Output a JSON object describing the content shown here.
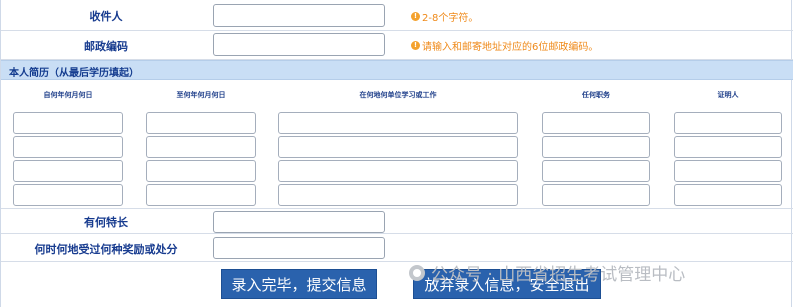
{
  "recipient": {
    "label": "收件人",
    "value": "",
    "hint": "2-8个字符。"
  },
  "postal": {
    "label": "邮政编码",
    "value": "",
    "hint": "请输入和邮寄地址对应的6位邮政编码。"
  },
  "resume": {
    "title": "本人简历（从最后学历填起）",
    "columns": [
      "自何年何月何日",
      "至何年何月何日",
      "在何地何单位学习或工作",
      "任何职务",
      "证明人"
    ],
    "rows": [
      [
        "",
        "",
        "",
        "",
        ""
      ],
      [
        "",
        "",
        "",
        "",
        ""
      ],
      [
        "",
        "",
        "",
        "",
        ""
      ],
      [
        "",
        "",
        "",
        "",
        ""
      ]
    ]
  },
  "specialty": {
    "label": "有何特长",
    "value": ""
  },
  "rewards": {
    "label": "何时何地受过何种奖励或处分",
    "value": ""
  },
  "buttons": {
    "submit": "录入完毕，提交信息",
    "abandon": "放弃录入信息，安全退出"
  },
  "watermark": "公众号 · 山西省招生考试管理中心",
  "colors": {
    "accent_blue": "#2a62ad",
    "section_bar": "#c9def5",
    "hint_orange": "#ef8a1a",
    "label_blue": "#173b8f"
  }
}
